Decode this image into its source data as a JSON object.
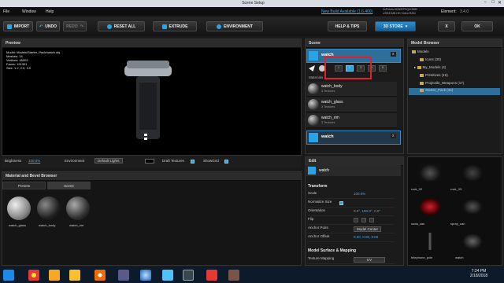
{
  "window": {
    "title": "Scene Setup"
  },
  "menu": {
    "file": "File",
    "window": "Window",
    "help": "Help",
    "build_notice": "New Build Available (1.6.400)",
    "status": "0xPoints 8GB/RPSQ4/3582",
    "gpu": "USE/DMB HD Video RAM",
    "element_label": "Element:",
    "element_value": "3.4.0"
  },
  "toolbar": {
    "import": "IMPORT",
    "undo": "UNDO",
    "redo": "REDO",
    "reset_all": "RESET ALL",
    "extrude": "EXTRUDE",
    "environment": "ENVIRONMENT",
    "help_tips": "HELP & TIPS",
    "store": "3D STORE",
    "close": "X",
    "ok": "OK"
  },
  "preview": {
    "header": "Preview",
    "stats": [
      "Model: Models/Starter_Pack/watch.obj",
      "Meshes: 14",
      "Vertices: 45003",
      "Faces: 191301",
      "Size: 1.2, 2.0, 3.0"
    ],
    "brightness_label": "Brightness",
    "brightness_value": "100.0%",
    "environment_label": "Environment",
    "environment_value": "Default Lights",
    "draft_textures": "Draft Textures",
    "show_grid": "ShowGrid"
  },
  "material_browser": {
    "header": "Material and Bevel Browser",
    "tabs": [
      "Presets",
      "Scene"
    ],
    "items": [
      "watch_glass",
      "watch_body",
      "watch_rim"
    ]
  },
  "scene": {
    "header": "Scene",
    "object": "watch",
    "close": "x",
    "materials_label": "Materials",
    "slots": [
      "1",
      "2",
      "3",
      "4",
      "5"
    ],
    "materials": [
      {
        "name": "watch_body",
        "sub": "3 Textures"
      },
      {
        "name": "watch_glass",
        "sub": "3 Textures"
      },
      {
        "name": "watch_rim",
        "sub": "3 Textures"
      }
    ],
    "object2": "watch"
  },
  "edit": {
    "header": "Edit",
    "object": "watch",
    "transform": "Transform",
    "props": [
      {
        "label": "Scale",
        "value": "100.0%"
      },
      {
        "label": "Normalize Size",
        "value": ""
      },
      {
        "label": "Orientation",
        "value": "0.0°, 180.0°, 0.0°"
      },
      {
        "label": "Flip",
        "value": ""
      },
      {
        "label": "Anchor Point",
        "value": "Model Center"
      },
      {
        "label": "Anchor Offset",
        "value": "0.00, 0.00, 0.00"
      }
    ],
    "surface": "Model Surface & Mapping",
    "mapping_label": "Texture Mapping",
    "mapping_value": "UV"
  },
  "model_browser": {
    "header": "Model Browser",
    "tree": [
      {
        "label": "Models",
        "level": 0
      },
      {
        "label": "Icons (30)",
        "level": 1
      },
      {
        "label": "My_Models (4)",
        "level": 1
      },
      {
        "label": "Primitives (16)",
        "level": 1
      },
      {
        "label": "Projectile_Weapons (17)",
        "level": 1
      },
      {
        "label": "Starter_Pack (34)",
        "level": 1
      }
    ],
    "thumbs": [
      "rock_02",
      "rock_03",
      "soda_can",
      "spray_can",
      "telephone_pole",
      "watch"
    ]
  },
  "taskbar": {
    "time": "7:24 PM",
    "date": "2/18/2018"
  },
  "colors": {
    "accent": "#2aa3e6",
    "selection": "#2e6e9a",
    "highlight_box": "#e0202a"
  }
}
